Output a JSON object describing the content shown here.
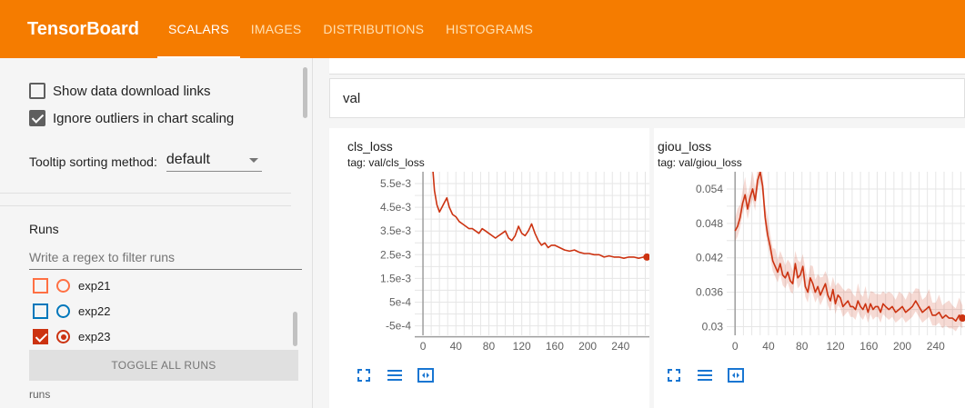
{
  "header": {
    "brand": "TensorBoard",
    "tabs": [
      {
        "label": "SCALARS",
        "active": true
      },
      {
        "label": "IMAGES",
        "active": false
      },
      {
        "label": "DISTRIBUTIONS",
        "active": false
      },
      {
        "label": "HISTOGRAMS",
        "active": false
      }
    ],
    "bg_color": "#f57c00"
  },
  "sidebar": {
    "show_download": {
      "label": "Show data download links",
      "checked": false
    },
    "ignore_outliers": {
      "label": "Ignore outliers in chart scaling",
      "checked": true
    },
    "tooltip": {
      "label": "Tooltip sorting method:",
      "value": "default"
    },
    "runs_title": "Runs",
    "regex_placeholder": "Write a regex to filter runs",
    "runs": [
      {
        "name": "exp21",
        "color": "#ff7043",
        "checked": false
      },
      {
        "name": "exp22",
        "color": "#0077bb",
        "checked": false
      },
      {
        "name": "exp23",
        "color": "#cc3311",
        "checked": true
      }
    ],
    "toggle_label": "TOGGLE ALL RUNS",
    "footer": "runs"
  },
  "main": {
    "group": "val",
    "charts": [
      {
        "title": "cls_loss",
        "tag": "tag: val/cls_loss",
        "color": "#cc3311",
        "y_ticks": [
          "5.5e-3",
          "4.5e-3",
          "3.5e-3",
          "2.5e-3",
          "1.5e-3",
          "5e-4",
          "-5e-4"
        ],
        "x_ticks": [
          "0",
          "40",
          "80",
          "120",
          "160",
          "200",
          "240"
        ],
        "chart_data": {
          "type": "line",
          "xlim": [
            -10,
            275
          ],
          "ylim": [
            -0.0009,
            0.006
          ],
          "x": [
            12,
            14,
            17,
            20,
            23,
            26,
            29,
            32,
            36,
            40,
            44,
            48,
            52,
            56,
            60,
            64,
            68,
            72,
            76,
            80,
            84,
            88,
            92,
            96,
            100,
            104,
            108,
            112,
            116,
            120,
            124,
            128,
            132,
            136,
            140,
            144,
            148,
            152,
            156,
            160,
            166,
            172,
            178,
            184,
            190,
            196,
            202,
            208,
            214,
            220,
            226,
            232,
            238,
            244,
            250,
            256,
            262,
            268,
            272
          ],
          "y": [
            0.0061,
            0.0052,
            0.0046,
            0.0043,
            0.0045,
            0.0047,
            0.0049,
            0.0045,
            0.0042,
            0.0041,
            0.0039,
            0.0038,
            0.0037,
            0.0036,
            0.0036,
            0.0035,
            0.0034,
            0.0036,
            0.0035,
            0.0034,
            0.0033,
            0.0032,
            0.0033,
            0.0034,
            0.0035,
            0.0032,
            0.0031,
            0.0033,
            0.0037,
            0.0034,
            0.0033,
            0.0035,
            0.0038,
            0.0034,
            0.0031,
            0.0029,
            0.003,
            0.0028,
            0.0029,
            0.0029,
            0.0028,
            0.0027,
            0.00265,
            0.0027,
            0.0026,
            0.00255,
            0.00255,
            0.0025,
            0.0025,
            0.0024,
            0.00245,
            0.0024,
            0.0024,
            0.00235,
            0.0024,
            0.0024,
            0.00235,
            0.0024,
            0.0024
          ]
        }
      },
      {
        "title": "giou_loss",
        "tag": "tag: val/giou_loss",
        "color": "#cc3311",
        "y_ticks": [
          "0.054",
          "0.048",
          "0.042",
          "0.036",
          "0.03"
        ],
        "x_ticks": [
          "0",
          "40",
          "80",
          "120",
          "160",
          "200",
          "240"
        ],
        "chart_data": {
          "type": "line",
          "xlim": [
            -10,
            275
          ],
          "ylim": [
            0.0285,
            0.057
          ],
          "x": [
            0,
            3,
            6,
            9,
            12,
            15,
            18,
            21,
            24,
            27,
            30,
            33,
            36,
            39,
            42,
            45,
            48,
            51,
            54,
            57,
            60,
            63,
            66,
            69,
            72,
            75,
            78,
            81,
            84,
            87,
            90,
            93,
            96,
            99,
            102,
            105,
            108,
            111,
            114,
            117,
            120,
            123,
            126,
            129,
            132,
            135,
            138,
            141,
            144,
            147,
            150,
            153,
            156,
            159,
            162,
            165,
            168,
            171,
            174,
            177,
            180,
            184,
            188,
            192,
            196,
            200,
            204,
            208,
            212,
            216,
            220,
            224,
            228,
            232,
            236,
            240,
            244,
            248,
            252,
            256,
            260,
            264,
            268,
            272
          ],
          "y": [
            0.0467,
            0.0475,
            0.049,
            0.0515,
            0.053,
            0.0505,
            0.0525,
            0.054,
            0.052,
            0.0555,
            0.057,
            0.0545,
            0.049,
            0.046,
            0.044,
            0.0415,
            0.0405,
            0.0395,
            0.041,
            0.039,
            0.0385,
            0.0395,
            0.038,
            0.0375,
            0.041,
            0.0385,
            0.039,
            0.0405,
            0.037,
            0.036,
            0.0385,
            0.0375,
            0.036,
            0.037,
            0.0355,
            0.0365,
            0.0375,
            0.0355,
            0.0345,
            0.0365,
            0.034,
            0.0355,
            0.035,
            0.0335,
            0.034,
            0.0345,
            0.0335,
            0.0335,
            0.033,
            0.0345,
            0.0335,
            0.033,
            0.034,
            0.0325,
            0.034,
            0.033,
            0.0335,
            0.0335,
            0.0325,
            0.034,
            0.0335,
            0.033,
            0.0335,
            0.0325,
            0.033,
            0.0335,
            0.0325,
            0.033,
            0.0335,
            0.0345,
            0.0335,
            0.0325,
            0.033,
            0.0335,
            0.032,
            0.032,
            0.0325,
            0.0315,
            0.032,
            0.0315,
            0.0315,
            0.031,
            0.032,
            0.0315
          ],
          "ci_upper_offset": 0.0022,
          "ci_lower_offset": 0.0018
        }
      }
    ]
  }
}
